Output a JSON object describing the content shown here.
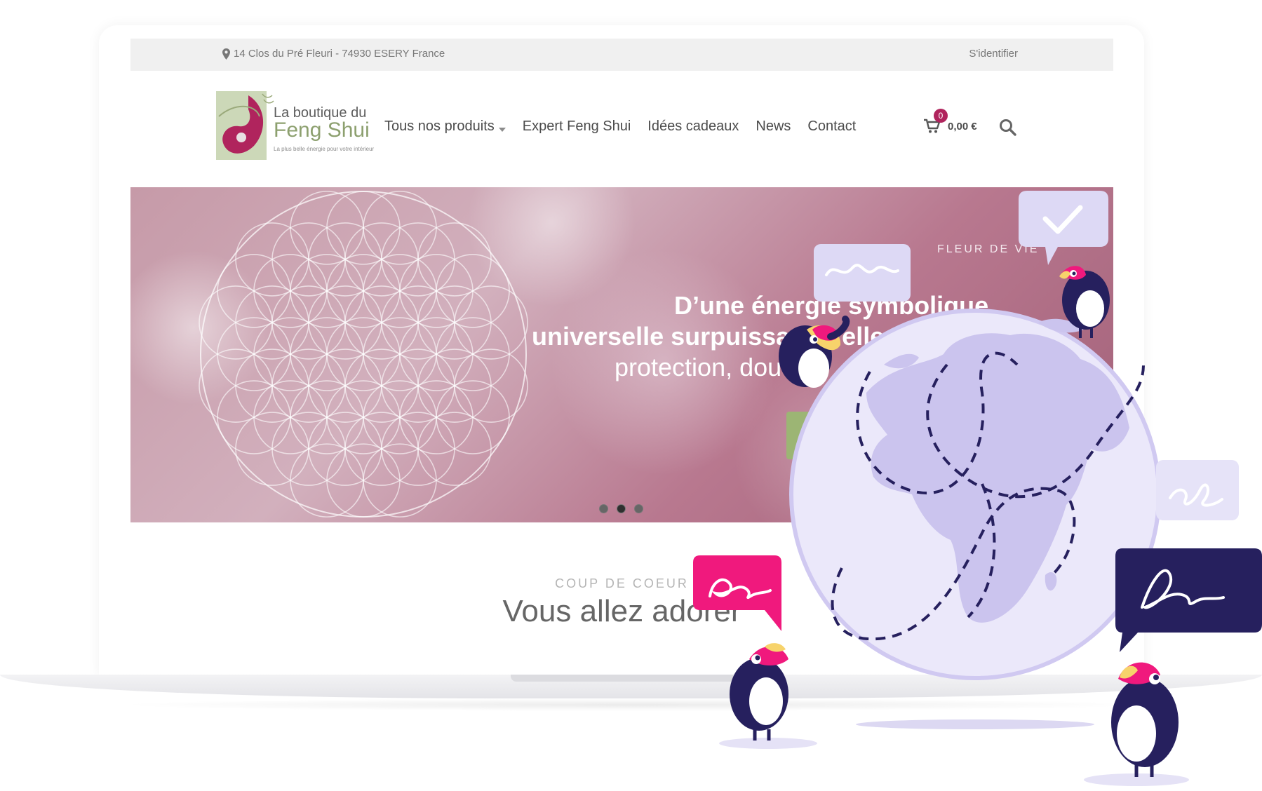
{
  "topbar": {
    "address": "14 Clos du Pré Fleuri - 74930 ESERY France",
    "login": "S'identifier"
  },
  "logo": {
    "line1": "La boutique du",
    "line2": "Feng Shui",
    "tagline": "La plus belle énergie pour votre intérieur"
  },
  "nav": {
    "items": [
      {
        "label": "Tous nos produits",
        "has_dropdown": true
      },
      {
        "label": "Expert Feng Shui"
      },
      {
        "label": "Idées cadeaux"
      },
      {
        "label": "News"
      },
      {
        "label": "Contact"
      }
    ]
  },
  "cart": {
    "count": "0",
    "total": "0,00 €"
  },
  "hero": {
    "kicker": "FLEUR DE VIE",
    "line1": "D’une énergie symbolique",
    "line2": "universelle surpuissante, elle",
    "line3": "protection, douceur",
    "slide_count": 3,
    "active_slide": 2
  },
  "section": {
    "kicker": "COUP DE COEUR",
    "title": "Vous allez adorer"
  },
  "colors": {
    "accent_pink": "#b0245d",
    "green": "#8da06f",
    "illustration_purple": "#d2cdf0",
    "illustration_navy": "#26205e",
    "illustration_magenta": "#f0197d"
  }
}
